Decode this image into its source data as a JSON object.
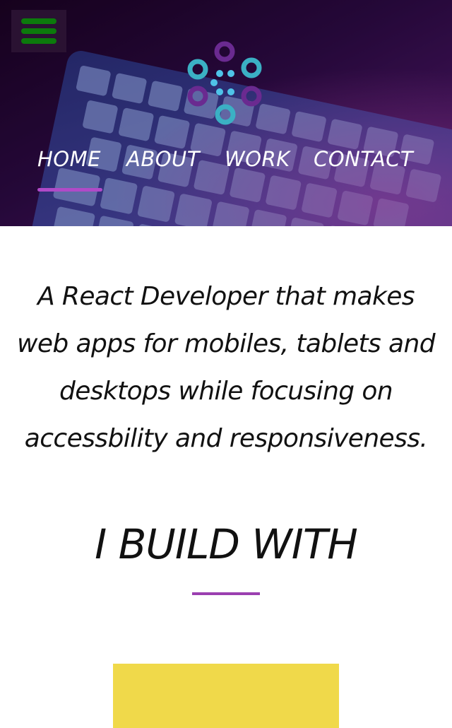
{
  "colors": {
    "hero_background": "#1a0428",
    "accent_purple": "#b04ac8",
    "menu_bars_green": "#0c7a0c",
    "tech_card_yellow": "#f0d94a",
    "logo_teal": "#3bb0c4",
    "logo_purple": "#6a2a90"
  },
  "header": {
    "menu_icon": "hamburger-menu-icon",
    "logo_icon": "dots-circles-logo-icon",
    "background_image": "laptop-keyboard-photo"
  },
  "nav": {
    "items": [
      {
        "label": "HOME",
        "active": true
      },
      {
        "label": "ABOUT",
        "active": false
      },
      {
        "label": "WORK",
        "active": false
      },
      {
        "label": "CONTACT",
        "active": false
      }
    ]
  },
  "intro": {
    "lines": [
      "A React Developer that makes",
      "web apps for mobiles, tablets and",
      "desktops while focusing on",
      "accessbility and responsiveness."
    ]
  },
  "skills": {
    "heading": "I BUILD WITH"
  }
}
